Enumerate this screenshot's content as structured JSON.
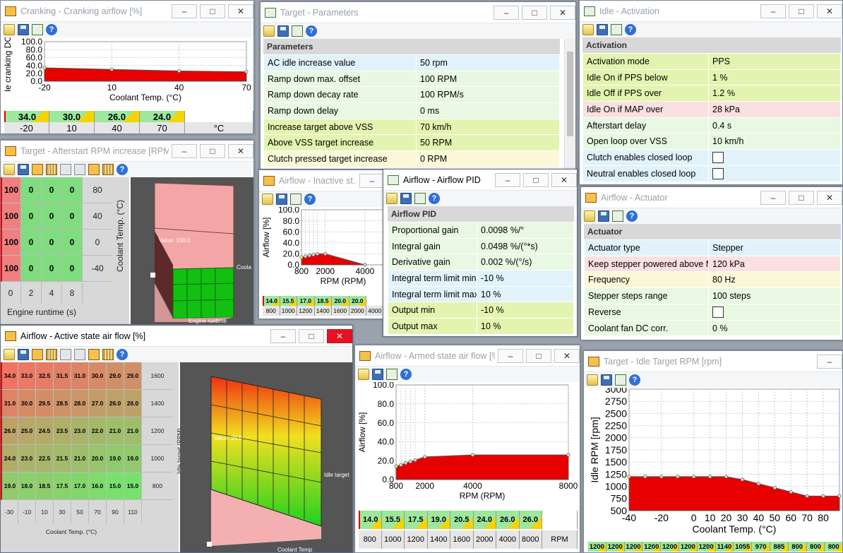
{
  "cranking": {
    "title": "Cranking - Cranking airflow [%]",
    "ylabel": "Idle cranking DC [%]",
    "ylabel_visible": "le cranking DC [",
    "xlabel": "Coolant Temp. (°C)",
    "yticks": [
      "100.0",
      "80.0",
      "60.0",
      "40.0",
      "20.0",
      "0.0"
    ],
    "xticks": [
      "-20",
      "10",
      "40",
      "70"
    ],
    "values": [
      "34.0",
      "30.0",
      "26.0",
      "24.0"
    ],
    "axis": [
      "-20",
      "10",
      "40",
      "70"
    ],
    "unit": "°C"
  },
  "target_params": {
    "title": "Target - Parameters",
    "section": "Parameters",
    "rows": [
      {
        "label": "AC idle increase value",
        "value": "50 rpm"
      },
      {
        "label": "Ramp down max. offset",
        "value": "100 RPM"
      },
      {
        "label": "Ramp down decay rate",
        "value": "100 RPM/s"
      },
      {
        "label": "Ramp down delay",
        "value": "0 ms"
      },
      {
        "label": "Increase target above VSS",
        "value": "70 km/h"
      },
      {
        "label": "Above VSS target increase",
        "value": "50 RPM"
      },
      {
        "label": "Clutch pressed target increase",
        "value": "0 RPM"
      }
    ]
  },
  "idle_activation": {
    "title": "Idle - Activation",
    "section": "Activation",
    "rows": [
      {
        "label": "Activation mode",
        "value": "PPS"
      },
      {
        "label": "Idle On if PPS below",
        "value": "1 %"
      },
      {
        "label": "Idle Off if PPS over",
        "value": "1.2 %"
      },
      {
        "label": "Idle On if MAP over",
        "value": "28 kPa"
      },
      {
        "label": "Afterstart delay",
        "value": "0.4 s"
      },
      {
        "label": "Open loop over VSS",
        "value": "10 km/h"
      },
      {
        "label": "Clutch enables closed loop",
        "value": ""
      },
      {
        "label": "Neutral enables closed loop",
        "value": ""
      }
    ]
  },
  "afterstart": {
    "title": "Target - Afterstart RPM increase [RPM]",
    "rows": [
      {
        "y": "80",
        "cells": [
          "100",
          "0",
          "0",
          "0"
        ]
      },
      {
        "y": "40",
        "cells": [
          "100",
          "0",
          "0",
          "0"
        ]
      },
      {
        "y": "0",
        "cells": [
          "100",
          "0",
          "0",
          "0"
        ]
      },
      {
        "y": "-40",
        "cells": [
          "100",
          "0",
          "0",
          "0"
        ]
      }
    ],
    "xaxis": [
      "0",
      "2",
      "4",
      "8"
    ],
    "xlabel": "Engine runtime (s)",
    "ylabel": "Coolant Temp. (°C)",
    "v_label": "Value: 100.0",
    "a_label1": "Coola",
    "a_label2": "Engine runtime"
  },
  "inactive": {
    "title": "Airflow - Inactive st...",
    "ylabel": "Airflow [%]",
    "xlabel": "RPM (RPM)",
    "yticks": [
      "100.0",
      "80.0",
      "60.0",
      "40.0",
      "20.0",
      "0.0"
    ],
    "xticks": [
      "800",
      "2000",
      "4000"
    ],
    "values": [
      "14.0",
      "15.5",
      "17.0",
      "18.5",
      "20.0",
      "20.0"
    ],
    "axis": [
      "800",
      "1000",
      "1200",
      "1400",
      "1600",
      "2000",
      "4000"
    ]
  },
  "pid": {
    "title": "Airflow - Airflow PID",
    "section": "Airflow PID",
    "rows": [
      {
        "label": "Proportional gain",
        "value": "0.0098 %/°"
      },
      {
        "label": "Integral gain",
        "value": "0.0498 %/(°*s)"
      },
      {
        "label": "Derivative gain",
        "value": "0.002 %/(°/s)"
      },
      {
        "label": "Integral term limit min",
        "value": "-10 %"
      },
      {
        "label": "Integral term limit max",
        "value": "10 %"
      },
      {
        "label": "Output min",
        "value": "-10 %"
      },
      {
        "label": "Output max",
        "value": "10 %"
      }
    ]
  },
  "actuator": {
    "title": "Airflow - Actuator",
    "section": "Actuator",
    "rows": [
      {
        "label": "Actuator type",
        "value": "Stepper"
      },
      {
        "label": "Keep stepper powered above MAP",
        "value": "120 kPa"
      },
      {
        "label": "Frequency",
        "value": "80 Hz"
      },
      {
        "label": "Stepper steps range",
        "value": "100 steps"
      },
      {
        "label": "Reverse",
        "value": ""
      },
      {
        "label": "Coolant fan DC corr.",
        "value": "0 %"
      }
    ]
  },
  "active": {
    "title": "Airflow - Active state air flow [%]",
    "rows": [
      {
        "y": "1600",
        "cells": [
          "34.0",
          "33.0",
          "32.5",
          "31.5",
          "31.0",
          "30.0",
          "29.0",
          "29.0"
        ]
      },
      {
        "y": "1400",
        "cells": [
          "31.0",
          "30.0",
          "29.5",
          "28.5",
          "28.0",
          "27.0",
          "26.0",
          "26.0"
        ]
      },
      {
        "y": "1200",
        "cells": [
          "26.0",
          "25.0",
          "24.5",
          "23.5",
          "23.0",
          "22.0",
          "21.0",
          "21.0"
        ]
      },
      {
        "y": "1000",
        "cells": [
          "24.0",
          "23.0",
          "22.5",
          "21.5",
          "21.0",
          "20.0",
          "19.0",
          "19.0"
        ]
      },
      {
        "y": "800",
        "cells": [
          "19.0",
          "18.0",
          "18.5",
          "17.5",
          "17.0",
          "16.0",
          "15.0",
          "15.0"
        ]
      }
    ],
    "xaxis": [
      "-30",
      "-10",
      "10",
      "30",
      "50",
      "70",
      "90",
      "110"
    ],
    "xlabel": "Coolant Temp. (°C)",
    "ylabel": "Idle target (RPM)",
    "v_label": "Value: 29.0",
    "a_label1": "Idle target",
    "a_label2": "Coolant Temp"
  },
  "armed": {
    "title": "Airflow - Armed state air flow [%]",
    "ylabel": "Airflow [%]",
    "xlabel": "RPM (RPM)",
    "yticks": [
      "100.0",
      "80.0",
      "60.0",
      "40.0",
      "20.0",
      "0.0"
    ],
    "xticks": [
      "800",
      "2000",
      "4000",
      "8000"
    ],
    "values": [
      "14.0",
      "15.5",
      "17.5",
      "19.0",
      "20.5",
      "24.0",
      "26.0",
      "26.0"
    ],
    "axis": [
      "800",
      "1000",
      "1200",
      "1400",
      "1600",
      "2000",
      "4000",
      "8000"
    ],
    "unit": "RPM"
  },
  "idle_target": {
    "title": "Target - Idle Target RPM [rpm]",
    "ylabel": "Idle RPM [rpm]",
    "xlabel": "Coolant Temp. (°C)",
    "yticks": [
      "3000",
      "2750",
      "2500",
      "2250",
      "2000",
      "1750",
      "1500",
      "1250",
      "1000",
      "750",
      "500"
    ],
    "xticks": [
      "-40",
      "-20",
      "0",
      "10",
      "20",
      "30",
      "40",
      "50",
      "60",
      "70",
      "80"
    ],
    "values": [
      "1200",
      "1200",
      "1200",
      "1200",
      "1200",
      "1200",
      "1200",
      "1140",
      "1055",
      "970",
      "885",
      "800",
      "800",
      "800"
    ]
  },
  "chart_data": [
    {
      "type": "area",
      "title": "Cranking - Cranking airflow [%]",
      "x": [
        -20,
        10,
        40,
        70
      ],
      "values": [
        34,
        30,
        26,
        24
      ],
      "xlabel": "Coolant Temp. (°C)",
      "ylabel": "Idle cranking DC [%]",
      "ylim": [
        0,
        100
      ],
      "xlim": [
        -20,
        70
      ],
      "grid": true
    },
    {
      "type": "area",
      "title": "Airflow - Inactive st...",
      "x": [
        800,
        1000,
        1200,
        1400,
        1600,
        2000,
        4000
      ],
      "values": [
        14,
        15.5,
        17,
        18.5,
        20,
        20,
        0
      ],
      "xlabel": "RPM (RPM)",
      "ylabel": "Airflow [%]",
      "ylim": [
        0,
        100
      ],
      "xlim": [
        800,
        5000
      ],
      "grid": true
    },
    {
      "type": "area",
      "title": "Airflow - Armed state air flow [%]",
      "x": [
        800,
        1000,
        1200,
        1400,
        1600,
        2000,
        4000,
        8000
      ],
      "values": [
        14,
        15.5,
        17.5,
        19,
        20.5,
        24,
        26,
        26
      ],
      "xlabel": "RPM (RPM)",
      "ylabel": "Airflow [%]",
      "ylim": [
        0,
        100
      ],
      "xlim": [
        800,
        8000
      ],
      "grid": true
    },
    {
      "type": "area",
      "title": "Target - Idle Target RPM [rpm]",
      "x": [
        -40,
        -30,
        -20,
        -10,
        0,
        10,
        20,
        30,
        40,
        50,
        60,
        70,
        80,
        90
      ],
      "values": [
        1200,
        1200,
        1200,
        1200,
        1200,
        1200,
        1200,
        1140,
        1055,
        970,
        885,
        800,
        800,
        800
      ],
      "xlabel": "Coolant Temp. (°C)",
      "ylabel": "Idle RPM [rpm]",
      "ylim": [
        500,
        3000
      ],
      "xlim": [
        -40,
        90
      ],
      "grid": true
    },
    {
      "type": "table",
      "title": "Target - Afterstart RPM increase [RPM]",
      "x": [
        0,
        2,
        4,
        8
      ],
      "y": [
        80,
        40,
        0,
        -40
      ],
      "values": [
        [
          100,
          0,
          0,
          0
        ],
        [
          100,
          0,
          0,
          0
        ],
        [
          100,
          0,
          0,
          0
        ],
        [
          100,
          0,
          0,
          0
        ]
      ]
    },
    {
      "type": "table",
      "title": "Airflow - Active state air flow [%]",
      "x": [
        -30,
        -10,
        10,
        30,
        50,
        70,
        90,
        110
      ],
      "y": [
        1600,
        1400,
        1200,
        1000,
        800
      ],
      "values": [
        [
          34,
          33,
          32.5,
          31.5,
          31,
          30,
          29,
          29
        ],
        [
          31,
          30,
          29.5,
          28.5,
          28,
          27,
          26,
          26
        ],
        [
          26,
          25,
          24.5,
          23.5,
          23,
          22,
          21,
          21
        ],
        [
          24,
          23,
          22.5,
          21.5,
          21,
          20,
          19,
          19
        ],
        [
          19,
          18,
          18.5,
          17.5,
          17,
          16,
          15,
          15
        ]
      ]
    }
  ],
  "colors": {
    "fill": "#e60000",
    "cell_green": "#7fdd7f",
    "cell_red": "#f08080",
    "row_blue": "#e1f2fb",
    "row_green": "#e8f8e2",
    "row_lime": "#e2f4b0",
    "row_yellow": "#fbf8d8",
    "row_pink": "#fae0e0"
  },
  "icons": [
    "folder-open-icon",
    "save-icon",
    "window-icon",
    "help-icon",
    "table-icon",
    "grid-icon",
    "columns-icon",
    "rows-icon"
  ]
}
